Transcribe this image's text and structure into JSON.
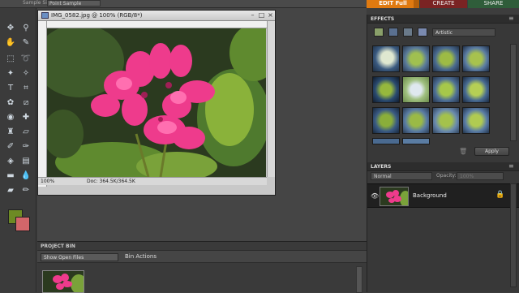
{
  "optbar": {
    "sample_label": "Sample Size:",
    "sample_value": "Point Sample"
  },
  "mode_tabs": {
    "edit": "EDIT Full",
    "create": "CREATE",
    "share": "SHARE"
  },
  "document": {
    "title": "IMG_0582.jpg @ 100% (RGB/8*)",
    "zoom": "100%",
    "doc_size": "Doc: 364.5K/364.5K"
  },
  "project_bin": {
    "title": "PROJECT BIN",
    "show_select": "Show Open Files",
    "bin_actions": "Bin Actions"
  },
  "effects": {
    "title": "EFFECTS",
    "category": "Artistic",
    "apply_label": "Apply"
  },
  "layers": {
    "title": "LAYERS",
    "blend_mode": "Normal",
    "opacity_label": "Opacity:",
    "opacity_value": "100%",
    "layer_name": "Background"
  },
  "colors": {
    "foreground": "#6d8a24",
    "background": "#d2666a",
    "edit_tab": "#e07a10",
    "create_tab": "#7a2323",
    "share_tab": "#2f5d3a"
  },
  "icons": {
    "tools": [
      "move-icon",
      "zoom-icon",
      "hand-icon",
      "eyedropper-icon",
      "marquee-icon",
      "lasso-icon",
      "magic-wand-icon",
      "quick-selection-icon",
      "type-icon",
      "crop-icon",
      "cookie-cutter-icon",
      "straighten-icon",
      "red-eye-icon",
      "healing-brush-icon",
      "clone-stamp-icon",
      "eraser-icon",
      "brush-icon",
      "smart-brush-icon",
      "paint-bucket-icon",
      "gradient-icon",
      "shape-icon",
      "blur-icon",
      "sponge-icon",
      "pencil-icon",
      "sharpen-icon"
    ]
  }
}
